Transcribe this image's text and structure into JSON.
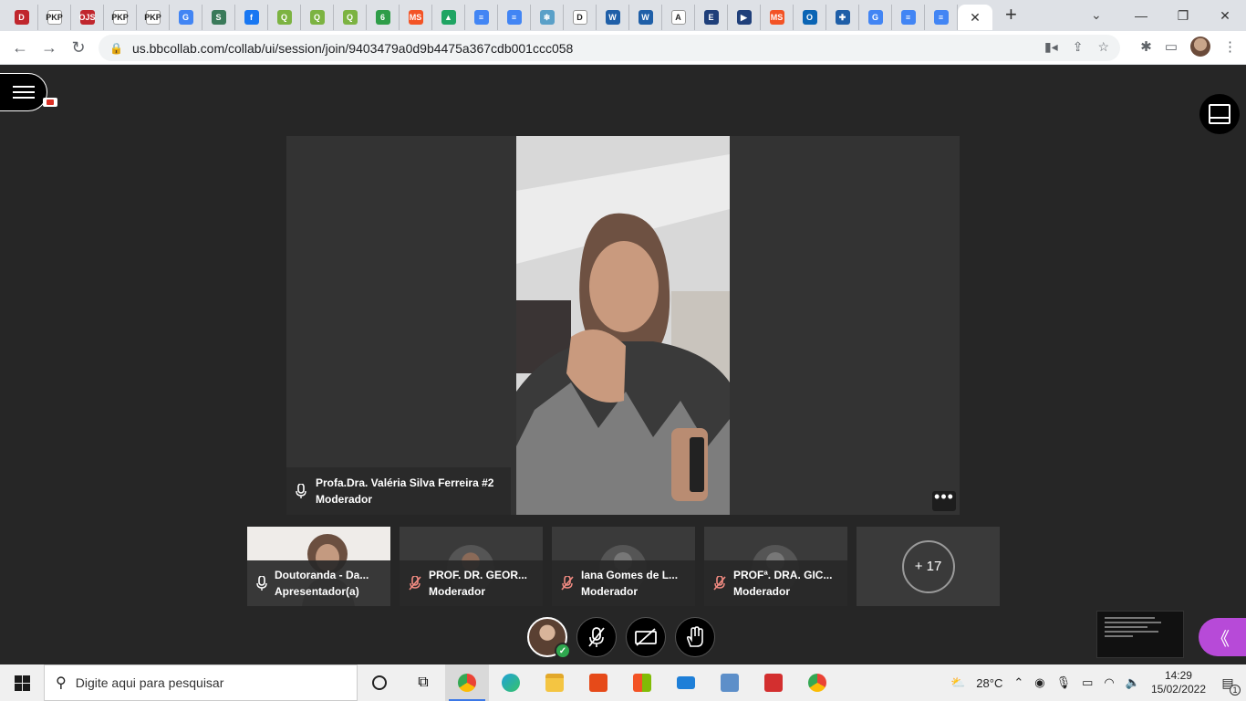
{
  "browser": {
    "tabs": [
      {
        "label": "D",
        "color": "#c0262d"
      },
      {
        "label": "PKP",
        "color": "#ffffff"
      },
      {
        "label": "OJS",
        "color": "#c0262d"
      },
      {
        "label": "PKP",
        "color": "#ffffff"
      },
      {
        "label": "PKP",
        "color": "#ffffff"
      },
      {
        "label": "G",
        "color": "#4285f4"
      },
      {
        "label": "S",
        "color": "#3a7a5a"
      },
      {
        "label": "f",
        "color": "#1877f2"
      },
      {
        "label": "Q",
        "color": "#7cb342"
      },
      {
        "label": "Q",
        "color": "#7cb342"
      },
      {
        "label": "Q",
        "color": "#7cb342"
      },
      {
        "label": "6",
        "color": "#2e9d48"
      },
      {
        "label": "MS",
        "color": "#f35325"
      },
      {
        "label": "▲",
        "color": "#1fa463"
      },
      {
        "label": "≡",
        "color": "#4285f4"
      },
      {
        "label": "≡",
        "color": "#4285f4"
      },
      {
        "label": "❄",
        "color": "#5aa0c8"
      },
      {
        "label": "D",
        "color": "#ffffff"
      },
      {
        "label": "W",
        "color": "#1f5fa8"
      },
      {
        "label": "W",
        "color": "#1f5fa8"
      },
      {
        "label": "A",
        "color": "#ffffff"
      },
      {
        "label": "E",
        "color": "#1f3f7a"
      },
      {
        "label": "▶",
        "color": "#1f3f7a"
      },
      {
        "label": "MS",
        "color": "#f35325"
      },
      {
        "label": "O",
        "color": "#0a64b4"
      },
      {
        "label": "✚",
        "color": "#1f5fa8"
      },
      {
        "label": "G",
        "color": "#4285f4"
      },
      {
        "label": "≡",
        "color": "#4285f4"
      },
      {
        "label": "≡",
        "color": "#4285f4"
      }
    ],
    "close_tab_glyph": "✕",
    "new_tab_glyph": "+",
    "url": "us.bbcollab.com/collab/ui/session/join/9403479a0d9b4475a367cdb001ccc058"
  },
  "collab": {
    "main_speaker": {
      "name": "Profa.Dra. Valéria Silva Ferreira #2",
      "role": "Moderador"
    },
    "more_glyph": "•••",
    "participants": [
      {
        "name": "Doutoranda - Da...",
        "role": "Apresentador(a)",
        "muted": false,
        "camera": true
      },
      {
        "name": "PROF. DR. GEOR...",
        "role": "Moderador",
        "muted": true,
        "camera": false
      },
      {
        "name": "Iana Gomes de L...",
        "role": "Moderador",
        "muted": true,
        "camera": false
      },
      {
        "name": "PROFª. DRA. GIC...",
        "role": "Moderador",
        "muted": true,
        "camera": false
      }
    ],
    "more_participants": "+ 17",
    "panel_glyph": "《"
  },
  "taskbar": {
    "search_placeholder": "Digite aqui para pesquisar",
    "temperature": "28°C",
    "time": "14:29",
    "date": "15/02/2022",
    "notifications": "1"
  }
}
